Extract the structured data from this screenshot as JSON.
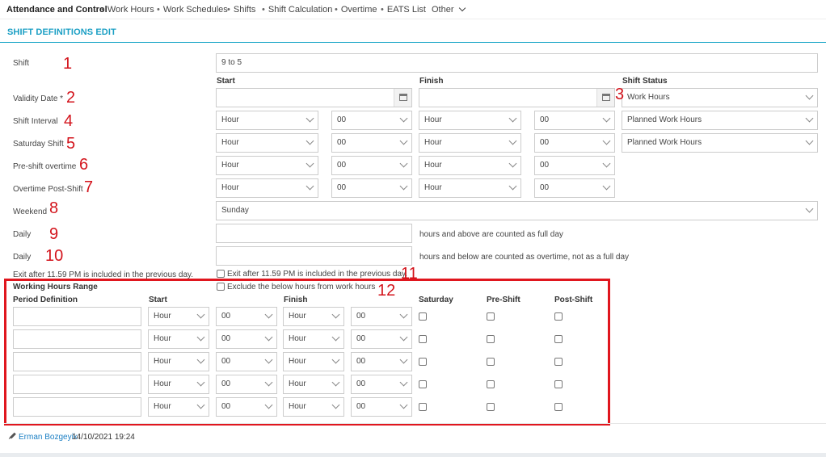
{
  "nav": {
    "brand": "Attendance and Control",
    "items": [
      "Work Hours",
      "Work Schedules",
      "Shifts",
      "Shift Calculation",
      "Overtime",
      "EATS List"
    ],
    "other": "Other"
  },
  "page": {
    "title": "SHIFT DEFINITIONS EDIT"
  },
  "form": {
    "shift_label": "Shift",
    "shift_value": "9 to 5",
    "col_start": "Start",
    "col_finish": "Finish",
    "col_status": "Shift Status",
    "validity_label": "Validity Date *",
    "status_value": "Work Hours",
    "interval_label": "Shift Interval",
    "saturday_label": "Saturday Shift",
    "preshift_label": "Pre-shift overtime",
    "postshift_label": "Overtime Post-Shift",
    "weekend_label": "Weekend",
    "weekend_value": "Sunday",
    "daily1_label": "Daily",
    "daily1_suffix": "hours and above are counted as full day",
    "daily2_label": "Daily",
    "daily2_suffix": "hours and below are counted as overtime, not as a full day",
    "exit_label": "Exit after 11.59 PM is included in the previous day.",
    "exit_check_label": "Exit after 11.59 PM is included in the previous day.",
    "exclude_check_label": "Exclude the below hours from work hours",
    "hour": "Hour",
    "minute": "00",
    "planned": "Planned Work Hours"
  },
  "range": {
    "title": "Working Hours Range",
    "col_period": "Period Definition",
    "col_start": "Start",
    "col_finish": "Finish",
    "col_saturday": "Saturday",
    "col_preshift": "Pre-Shift",
    "col_postshift": "Post-Shift",
    "hour": "Hour",
    "minute": "00"
  },
  "annotations": [
    "1",
    "2",
    "3",
    "4",
    "5",
    "6",
    "7",
    "8",
    "9",
    "10",
    "11",
    "12"
  ],
  "footer": {
    "user": "Erman Bozgeyik",
    "timestamp": "14/10/2021 19:24"
  },
  "colors": {
    "accent": "#1b9fc4",
    "annotation": "#d3141c"
  }
}
